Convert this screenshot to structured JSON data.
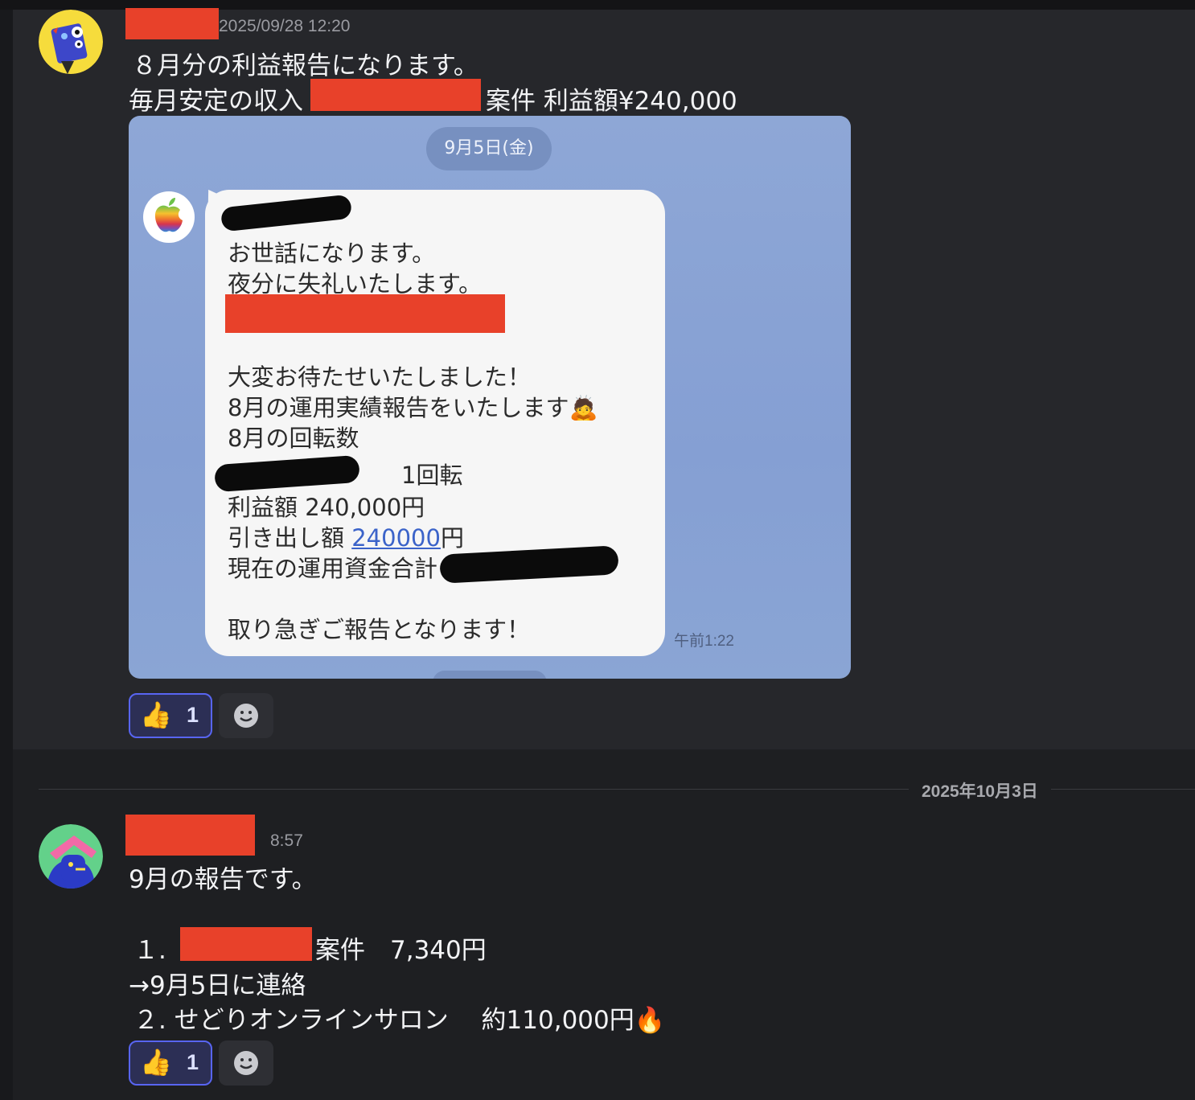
{
  "message1": {
    "timestamp": "2025/09/28 12:20",
    "line1": "８月分の利益報告になります。",
    "line2_prefix": "毎月安定の収入",
    "line2_suffix": "案件 利益額¥240,000",
    "attachment": {
      "date_pill": "9月5日(金)",
      "lines": [
        "お世話になります。",
        "夜分に失礼いたします。",
        "大変お待たせいたしました！",
        "8月の運用実績報告をいたします🙇",
        "8月の回転数",
        "1回転",
        "利益額 240,000円",
        "引き出し額",
        "240000",
        "円",
        "現在の運用資金合計",
        "取り急ぎご報告となります！"
      ],
      "time": "午前1:22"
    },
    "reaction": {
      "emoji": "👍",
      "count": "1"
    }
  },
  "divider_date": "2025年10月3日",
  "message2": {
    "timestamp": "8:57",
    "line1": "9月の報告です。",
    "item1_num": "１.",
    "item1_suffix": "案件　7,340円",
    "item1_note": "→9月5日に連絡",
    "item2": "２.  せどりオンラインサロン　 約110,000円🔥",
    "reaction": {
      "emoji": "👍",
      "count": "1"
    }
  },
  "colors": {
    "background": "#1e1f22",
    "redaction": "#e8412a",
    "reaction_border": "#5865f2",
    "line_bg": "#8ea7d6"
  }
}
